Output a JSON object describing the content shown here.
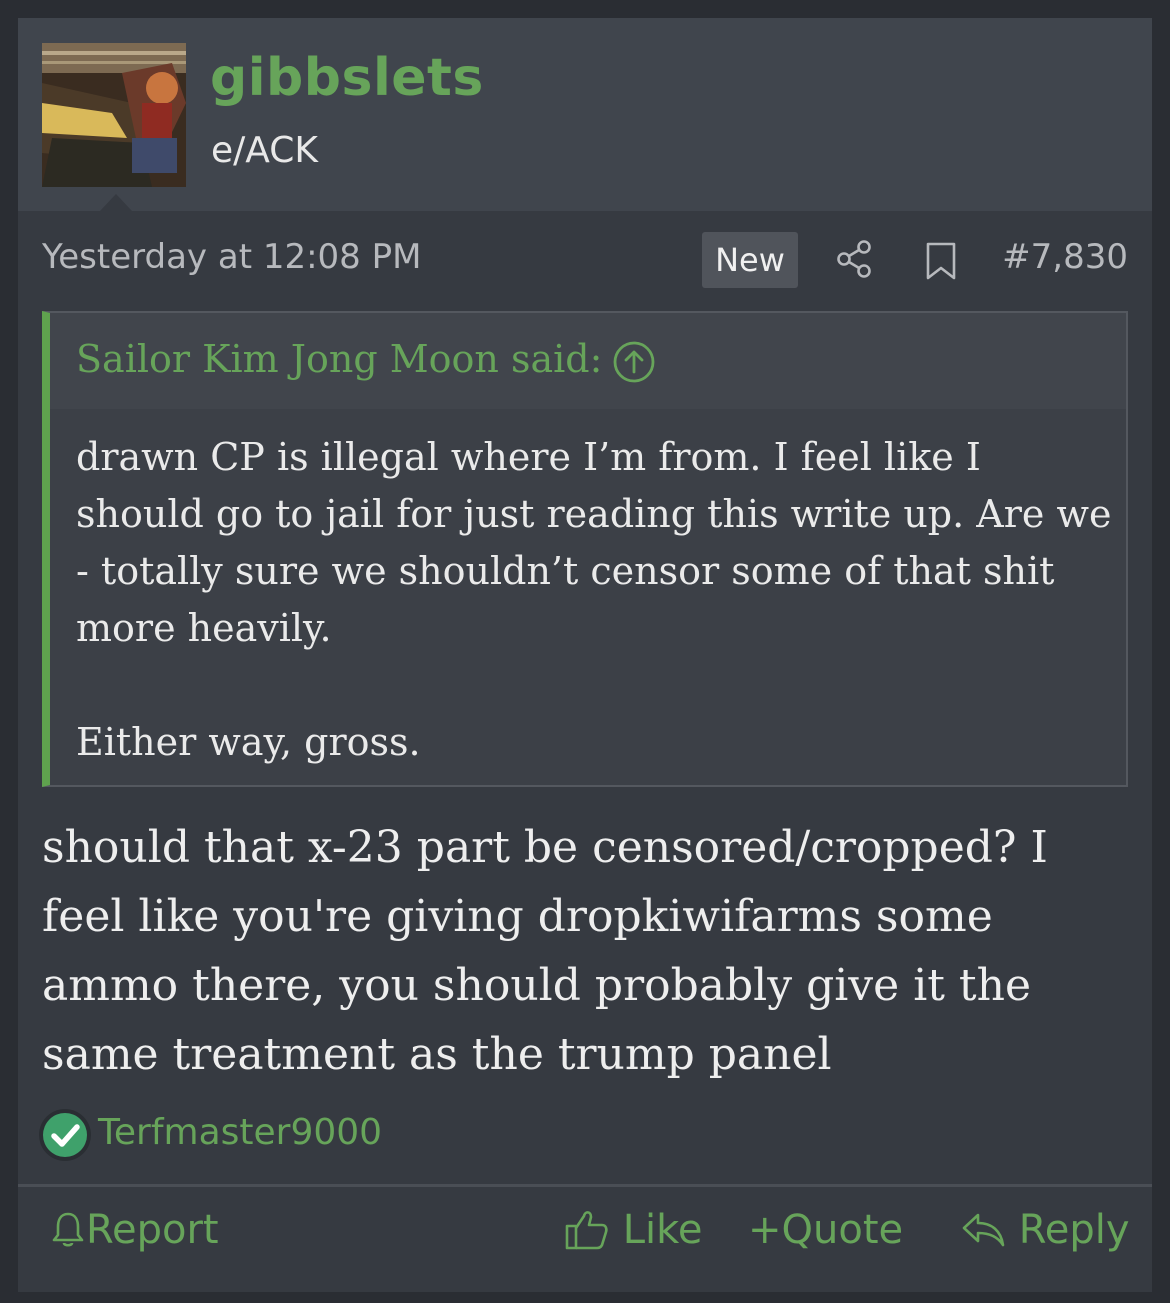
{
  "post": {
    "username": "gibbslets",
    "user_title": "e/ACK",
    "timestamp": "Yesterday at 12:08 PM",
    "new_badge": "New",
    "post_number": "#7,830",
    "quote": {
      "author": "Sailor Kim Jong Moon said:",
      "body": "drawn CP is illegal where I’m from. I feel like I should go to jail for just reading this write up. Are we - totally sure we shouldn’t censor some of that shit more heavily.\n\nEither way, gross."
    },
    "message": "should that x-23 part be censored/cropped? I feel like you're giving dropkiwifarms some ammo there, you should probably give it the same treatment as the trump panel",
    "reaction": {
      "user": "Terfmaster9000",
      "icon": "checkmark-icon"
    },
    "actions": {
      "report": "Report",
      "like": "Like",
      "quote": "Quote",
      "reply": "Reply"
    }
  },
  "colors": {
    "accent": "#67a45a",
    "quote_border": "#5fa24e",
    "background": "#363a41",
    "header": "#40454d"
  }
}
